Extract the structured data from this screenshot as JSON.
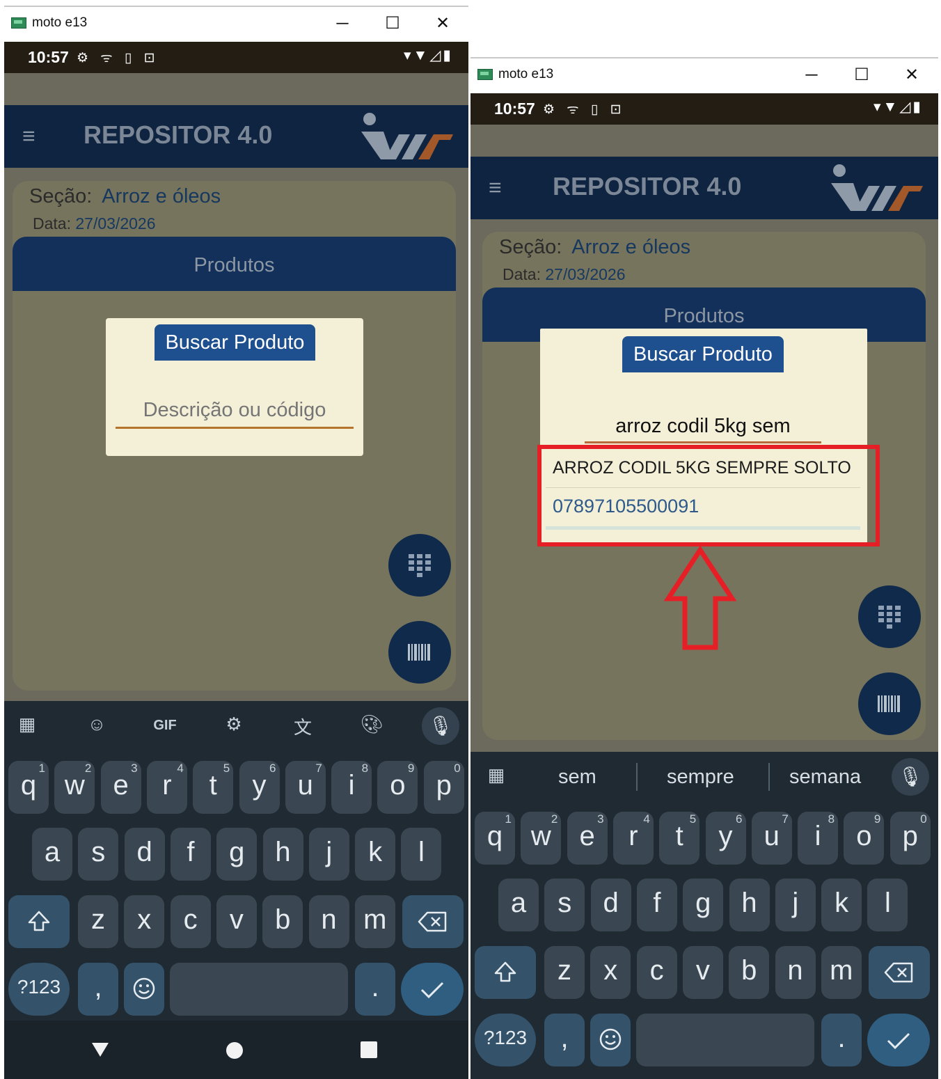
{
  "window": {
    "title": "moto e13",
    "controls": {
      "minimize": "─",
      "maximize": "☐",
      "close": "✕"
    }
  },
  "status": {
    "time": "10:57",
    "left_icons": "⚙ ᯤ ▯ ⊡",
    "right_icons": "▾▼◿▮"
  },
  "app": {
    "title": "REPOSITOR 4.0",
    "menu_icon": "≡"
  },
  "section": {
    "label": "Seção:",
    "value": "Arroz e óleos",
    "date_label": "Data:",
    "date_value": "27/03/2026"
  },
  "products_header": "Produtos",
  "dialog": {
    "button": "Buscar Produto",
    "placeholder": "Descrição ou código",
    "typed_query": "arroz codil 5kg sem"
  },
  "result": {
    "name": "ARROZ CODIL 5KG SEMPRE SOLTO",
    "code": "07897105500091"
  },
  "keyboard": {
    "tools": {
      "gif": "GIF"
    },
    "suggestions": [
      "sem",
      "sempre",
      "semana"
    ],
    "row1": [
      {
        "k": "q",
        "n": "1"
      },
      {
        "k": "w",
        "n": "2"
      },
      {
        "k": "e",
        "n": "3"
      },
      {
        "k": "r",
        "n": "4"
      },
      {
        "k": "t",
        "n": "5"
      },
      {
        "k": "y",
        "n": "6"
      },
      {
        "k": "u",
        "n": "7"
      },
      {
        "k": "i",
        "n": "8"
      },
      {
        "k": "o",
        "n": "9"
      },
      {
        "k": "p",
        "n": "0"
      }
    ],
    "row2": [
      "a",
      "s",
      "d",
      "f",
      "g",
      "h",
      "j",
      "k",
      "l"
    ],
    "row3": [
      "z",
      "x",
      "c",
      "v",
      "b",
      "n",
      "m"
    ],
    "symbols": "?123",
    "comma": ",",
    "period": "."
  },
  "colors": {
    "appbar": "#0e2440",
    "accent": "#1e4f8e",
    "highlight": "#e51f25",
    "dialog": "#f4f0d8",
    "code": "#2d5a8a"
  }
}
